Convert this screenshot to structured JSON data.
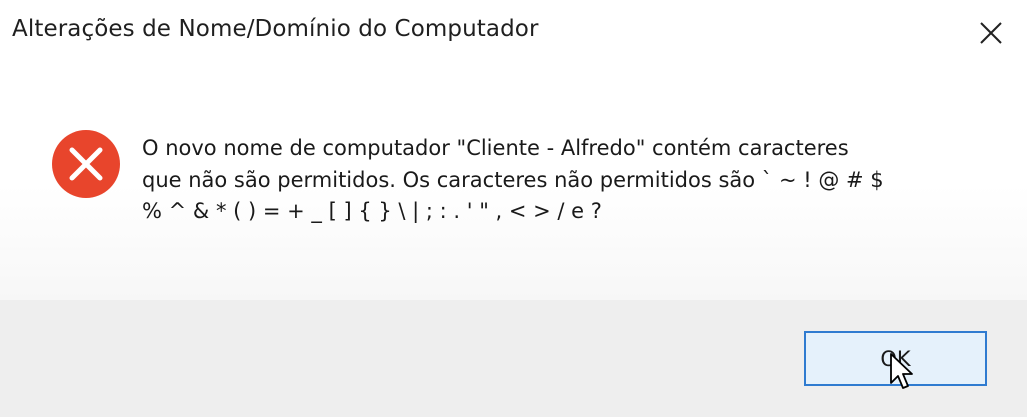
{
  "window": {
    "title": "Alterações de Nome/Domínio do Computador",
    "close_icon": "close-icon"
  },
  "message": {
    "icon": "error-icon",
    "lines": [
      "O novo nome de computador \"Cliente - Alfredo\" contém caracteres",
      "que não são permitidos. Os caracteres não permitidos são ` ~ ! @ # $",
      "% ^ & * ( ) = + _ [ ] { } \\ | ; : . ' \" , < > / e ?"
    ]
  },
  "buttons": {
    "ok_label": "OK"
  },
  "colors": {
    "error_red": "#e8452c",
    "footer_bg": "#eeeeee",
    "button_border": "#2f7bd0",
    "button_bg": "#e5f1fb"
  }
}
